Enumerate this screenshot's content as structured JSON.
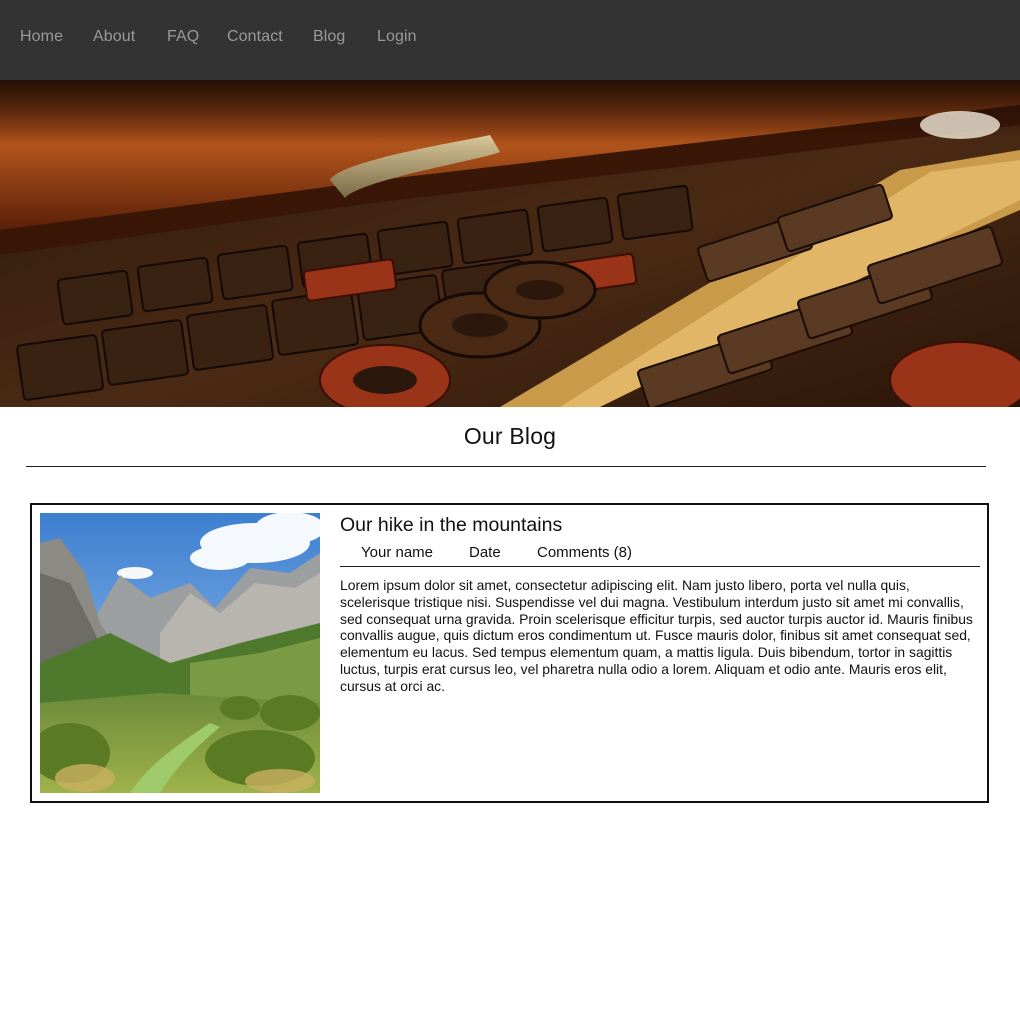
{
  "nav": {
    "items": [
      {
        "label": "Home"
      },
      {
        "label": "About"
      },
      {
        "label": "FAQ"
      },
      {
        "label": "Contact"
      },
      {
        "label": "Blog"
      },
      {
        "label": "Login"
      }
    ]
  },
  "hero": {
    "image": "letterpress-type-drawer-photo"
  },
  "page": {
    "title": "Our Blog"
  },
  "post": {
    "image": "mountain-valley-photo",
    "title": "Our hike in the mountains",
    "meta": {
      "author": "Your name",
      "date": "Date",
      "comments": "Comments (8)"
    },
    "body": "Lorem ipsum dolor sit amet, consectetur adipiscing elit. Nam justo libero, porta vel nulla quis, scelerisque tristique nisi. Suspendisse vel dui magna. Vestibulum interdum justo sit amet mi convallis, sed consequat urna gravida. Proin scelerisque efficitur turpis, sed auctor turpis auctor id. Mauris finibus convallis augue, quis dictum eros condimentum ut. Fusce mauris dolor, finibus sit amet consequat sed, elementum eu lacus. Sed tempus elementum quam, a mattis ligula. Duis bibendum, tortor in sagittis luctus, turpis erat cursus leo, vel pharetra nulla odio a lorem. Aliquam et odio ante. Mauris eros elit, cursus at orci ac."
  },
  "colors": {
    "nav_background": "#333333",
    "nav_text": "#9a9a9a",
    "text": "#111111",
    "border": "#111111"
  }
}
